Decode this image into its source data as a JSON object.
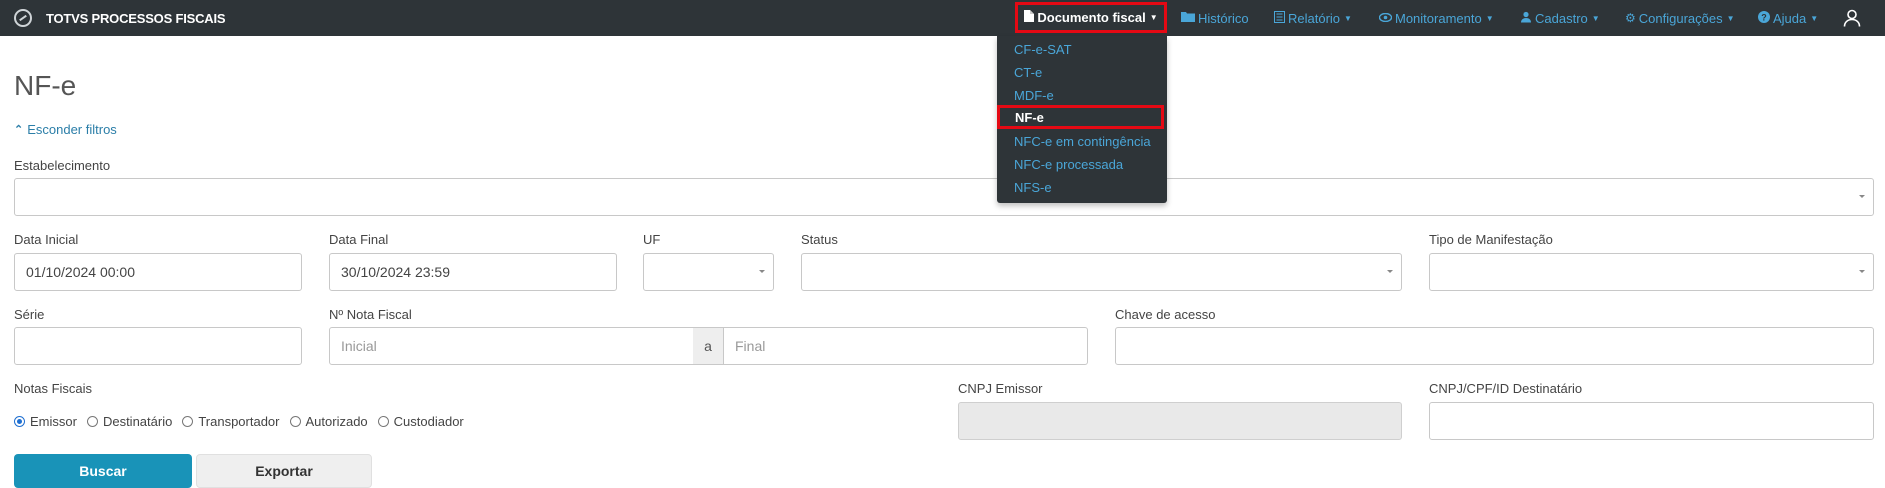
{
  "navbar": {
    "brand": "TOTVS PROCESSOS FISCAIS",
    "items": [
      {
        "label": "Documento fiscal",
        "icon": "file-icon"
      },
      {
        "label": "Histórico",
        "icon": "folder-icon"
      },
      {
        "label": "Relatório",
        "icon": "report-icon"
      },
      {
        "label": "Monitoramento",
        "icon": "eye-icon"
      },
      {
        "label": "Cadastro",
        "icon": "user-edit-icon"
      },
      {
        "label": "Configurações",
        "icon": "gear-icon"
      },
      {
        "label": "Ajuda",
        "icon": "help-icon"
      }
    ],
    "user_icon": "user-icon"
  },
  "dropdown": {
    "items": [
      "CF-e-SAT",
      "CT-e",
      "MDF-e",
      "NF-e",
      "NFC-e em contingência",
      "NFC-e processada",
      "NFS-e"
    ],
    "selected": "NF-e"
  },
  "page": {
    "title": "NF-e",
    "toggle_filters": "Esconder filtros"
  },
  "filters": {
    "estabelecimento": {
      "label": "Estabelecimento",
      "value": ""
    },
    "data_inicial": {
      "label": "Data Inicial",
      "value": "01/10/2024 00:00"
    },
    "data_final": {
      "label": "Data Final",
      "value": "30/10/2024 23:59"
    },
    "uf": {
      "label": "UF",
      "value": ""
    },
    "status": {
      "label": "Status",
      "value": ""
    },
    "tipo_manifestacao": {
      "label": "Tipo de Manifestação",
      "value": ""
    },
    "serie": {
      "label": "Série",
      "value": ""
    },
    "nota_fiscal": {
      "label": "Nº Nota Fiscal",
      "placeholder_inicial": "Inicial",
      "separator": "a",
      "placeholder_final": "Final"
    },
    "chave_acesso": {
      "label": "Chave de acesso",
      "value": ""
    },
    "notas_fiscais": {
      "label": "Notas Fiscais",
      "options": [
        "Emissor",
        "Destinatário",
        "Transportador",
        "Autorizado",
        "Custodiador"
      ],
      "selected": "Emissor"
    },
    "cnpj_emissor": {
      "label": "CNPJ Emissor",
      "value": ""
    },
    "cnpj_destinatario": {
      "label": "CNPJ/CPF/ID Destinatário",
      "value": ""
    }
  },
  "buttons": {
    "buscar": "Buscar",
    "exportar": "Exportar"
  },
  "colors": {
    "navbar_bg": "#2e3438",
    "link": "#4aa6d8",
    "highlight": "#e50914",
    "primary": "#1993b8"
  }
}
